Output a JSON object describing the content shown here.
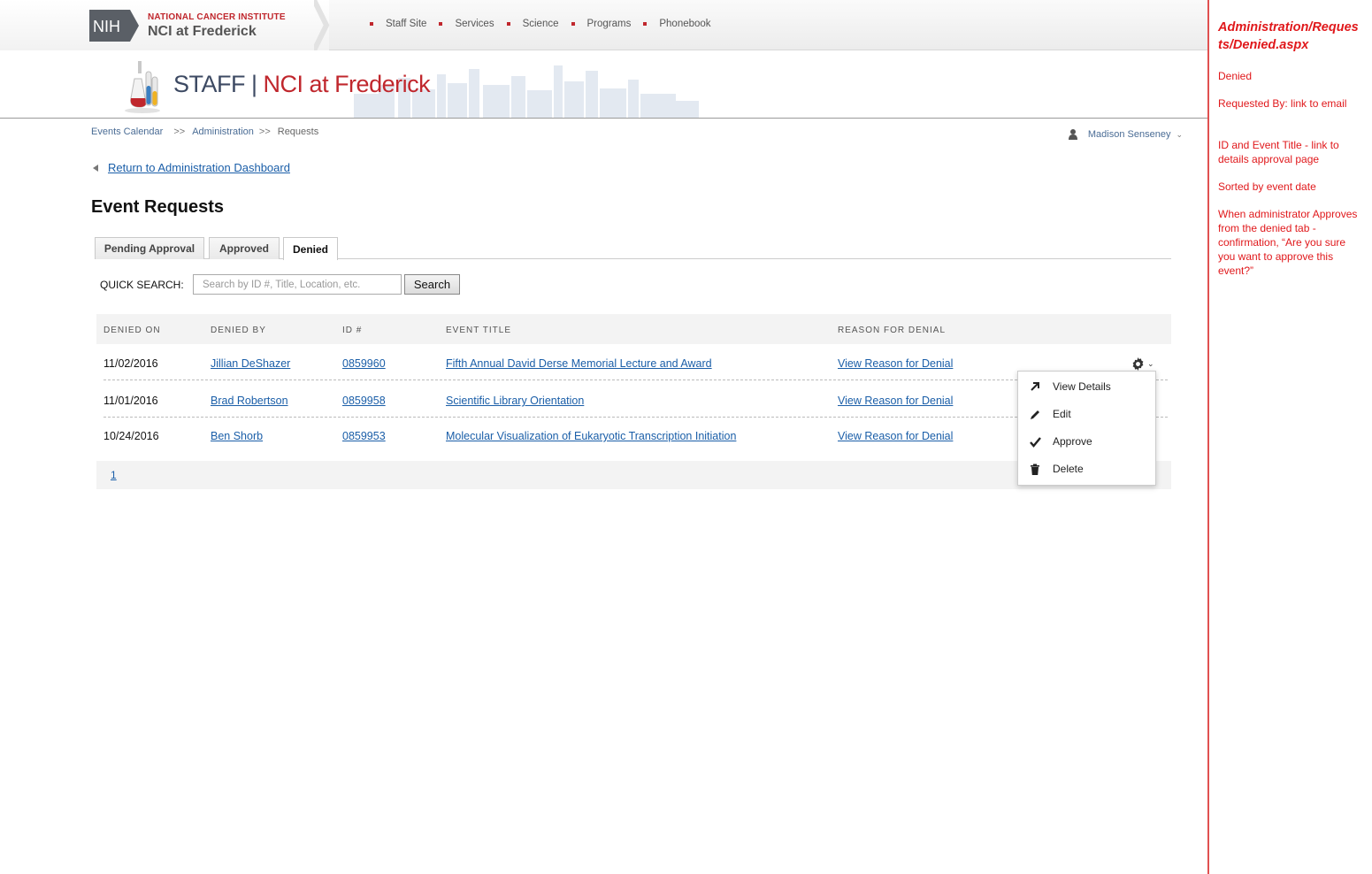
{
  "header": {
    "nih_logo": "NIH",
    "institute_line1": "NATIONAL CANCER INSTITUTE",
    "institute_line2": "NCI at Frederick",
    "nav": [
      "Staff Site",
      "Services",
      "Science",
      "Programs",
      "Phonebook"
    ],
    "banner_prefix": "STAFF",
    "banner_divider": "|",
    "banner_title": "NCI at Frederick"
  },
  "breadcrumb": {
    "items": [
      "Events Calendar",
      "Administration",
      "Requests"
    ],
    "separator": ">>"
  },
  "user": {
    "name": "Madison Senseney",
    "icon": "user-icon"
  },
  "return_link": "Return to Administration Dashboard",
  "page_title": "Event Requests",
  "tabs": [
    {
      "label": "Pending Approval",
      "active": false
    },
    {
      "label": "Approved",
      "active": false
    },
    {
      "label": "Denied",
      "active": true
    }
  ],
  "search": {
    "label": "QUICK SEARCH:",
    "placeholder": "Search by ID #, Title, Location, etc.",
    "button": "Search"
  },
  "table": {
    "columns": [
      "DENIED ON",
      "DENIED BY",
      "ID #",
      "EVENT TITLE",
      "REASON FOR DENIAL"
    ],
    "rows": [
      {
        "date": "11/02/2016",
        "by": "Jillian DeShazer",
        "id": "0859960",
        "title": "Fifth Annual David Derse Memorial Lecture and Award",
        "reason": "View Reason for Denial"
      },
      {
        "date": "11/01/2016",
        "by": "Brad Robertson",
        "id": "0859958",
        "title": "Scientific Library Orientation",
        "reason": "View Reason for Denial"
      },
      {
        "date": "10/24/2016",
        "by": "Ben Shorb",
        "id": "0859953",
        "title": "Molecular Visualization of Eukaryotic Transcription Initiation",
        "reason": "View Reason for Denial"
      }
    ]
  },
  "pager": {
    "current": "1"
  },
  "actions_menu": {
    "items": [
      {
        "label": "View Details",
        "icon": "arrow-up-right-icon"
      },
      {
        "label": "Edit",
        "icon": "pencil-icon"
      },
      {
        "label": "Approve",
        "icon": "checkmark-icon"
      },
      {
        "label": "Delete",
        "icon": "trash-icon"
      }
    ]
  },
  "annotations": {
    "title": "Administration/Requests/Denied.aspx",
    "notes": [
      "Denied",
      "Requested By: link to email",
      "ID and Event Title - link to details approval page",
      "Sorted by  event date",
      "When administrator Approves from the denied tab - confirmation, “Are you sure you want to approve this event?”"
    ]
  },
  "colors": {
    "brand_red": "#c0272d",
    "link_blue": "#1a5ea8",
    "annotation_red": "#e0181b"
  }
}
